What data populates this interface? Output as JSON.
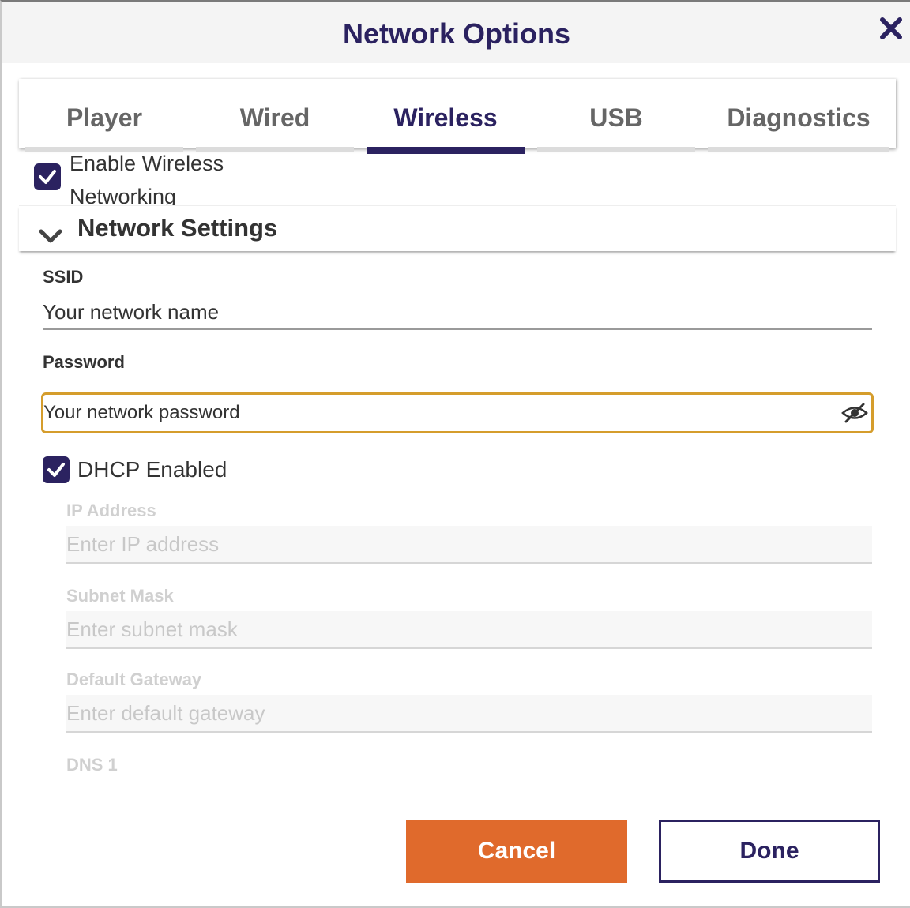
{
  "dialog": {
    "title": "Network Options",
    "close_icon": "close-icon"
  },
  "tabs": [
    {
      "label": "Player",
      "active": false
    },
    {
      "label": "Wired",
      "active": false
    },
    {
      "label": "Wireless",
      "active": true
    },
    {
      "label": "USB",
      "active": false
    },
    {
      "label": "Diagnostics",
      "active": false
    }
  ],
  "wireless": {
    "enable_label": "Enable Wireless Networking",
    "enable_checked": true,
    "section_title": "Network Settings",
    "section_expanded": true,
    "ssid": {
      "label": "SSID",
      "value": "Your network name"
    },
    "password": {
      "label": "Password",
      "value": "Your network password",
      "toggle_icon": "eye-slash-icon"
    },
    "dhcp": {
      "label": "DHCP Enabled",
      "checked": true
    },
    "ip": {
      "label": "IP Address",
      "placeholder": "Enter IP address"
    },
    "subnet": {
      "label": "Subnet Mask",
      "placeholder": "Enter subnet mask"
    },
    "gateway": {
      "label": "Default Gateway",
      "placeholder": "Enter default gateway"
    },
    "dns1": {
      "label": "DNS 1"
    }
  },
  "footer": {
    "cancel_label": "Cancel",
    "done_label": "Done"
  },
  "colors": {
    "brand": "#2b2260",
    "cancel": "#e06a2c",
    "focus": "#d59d2c"
  }
}
